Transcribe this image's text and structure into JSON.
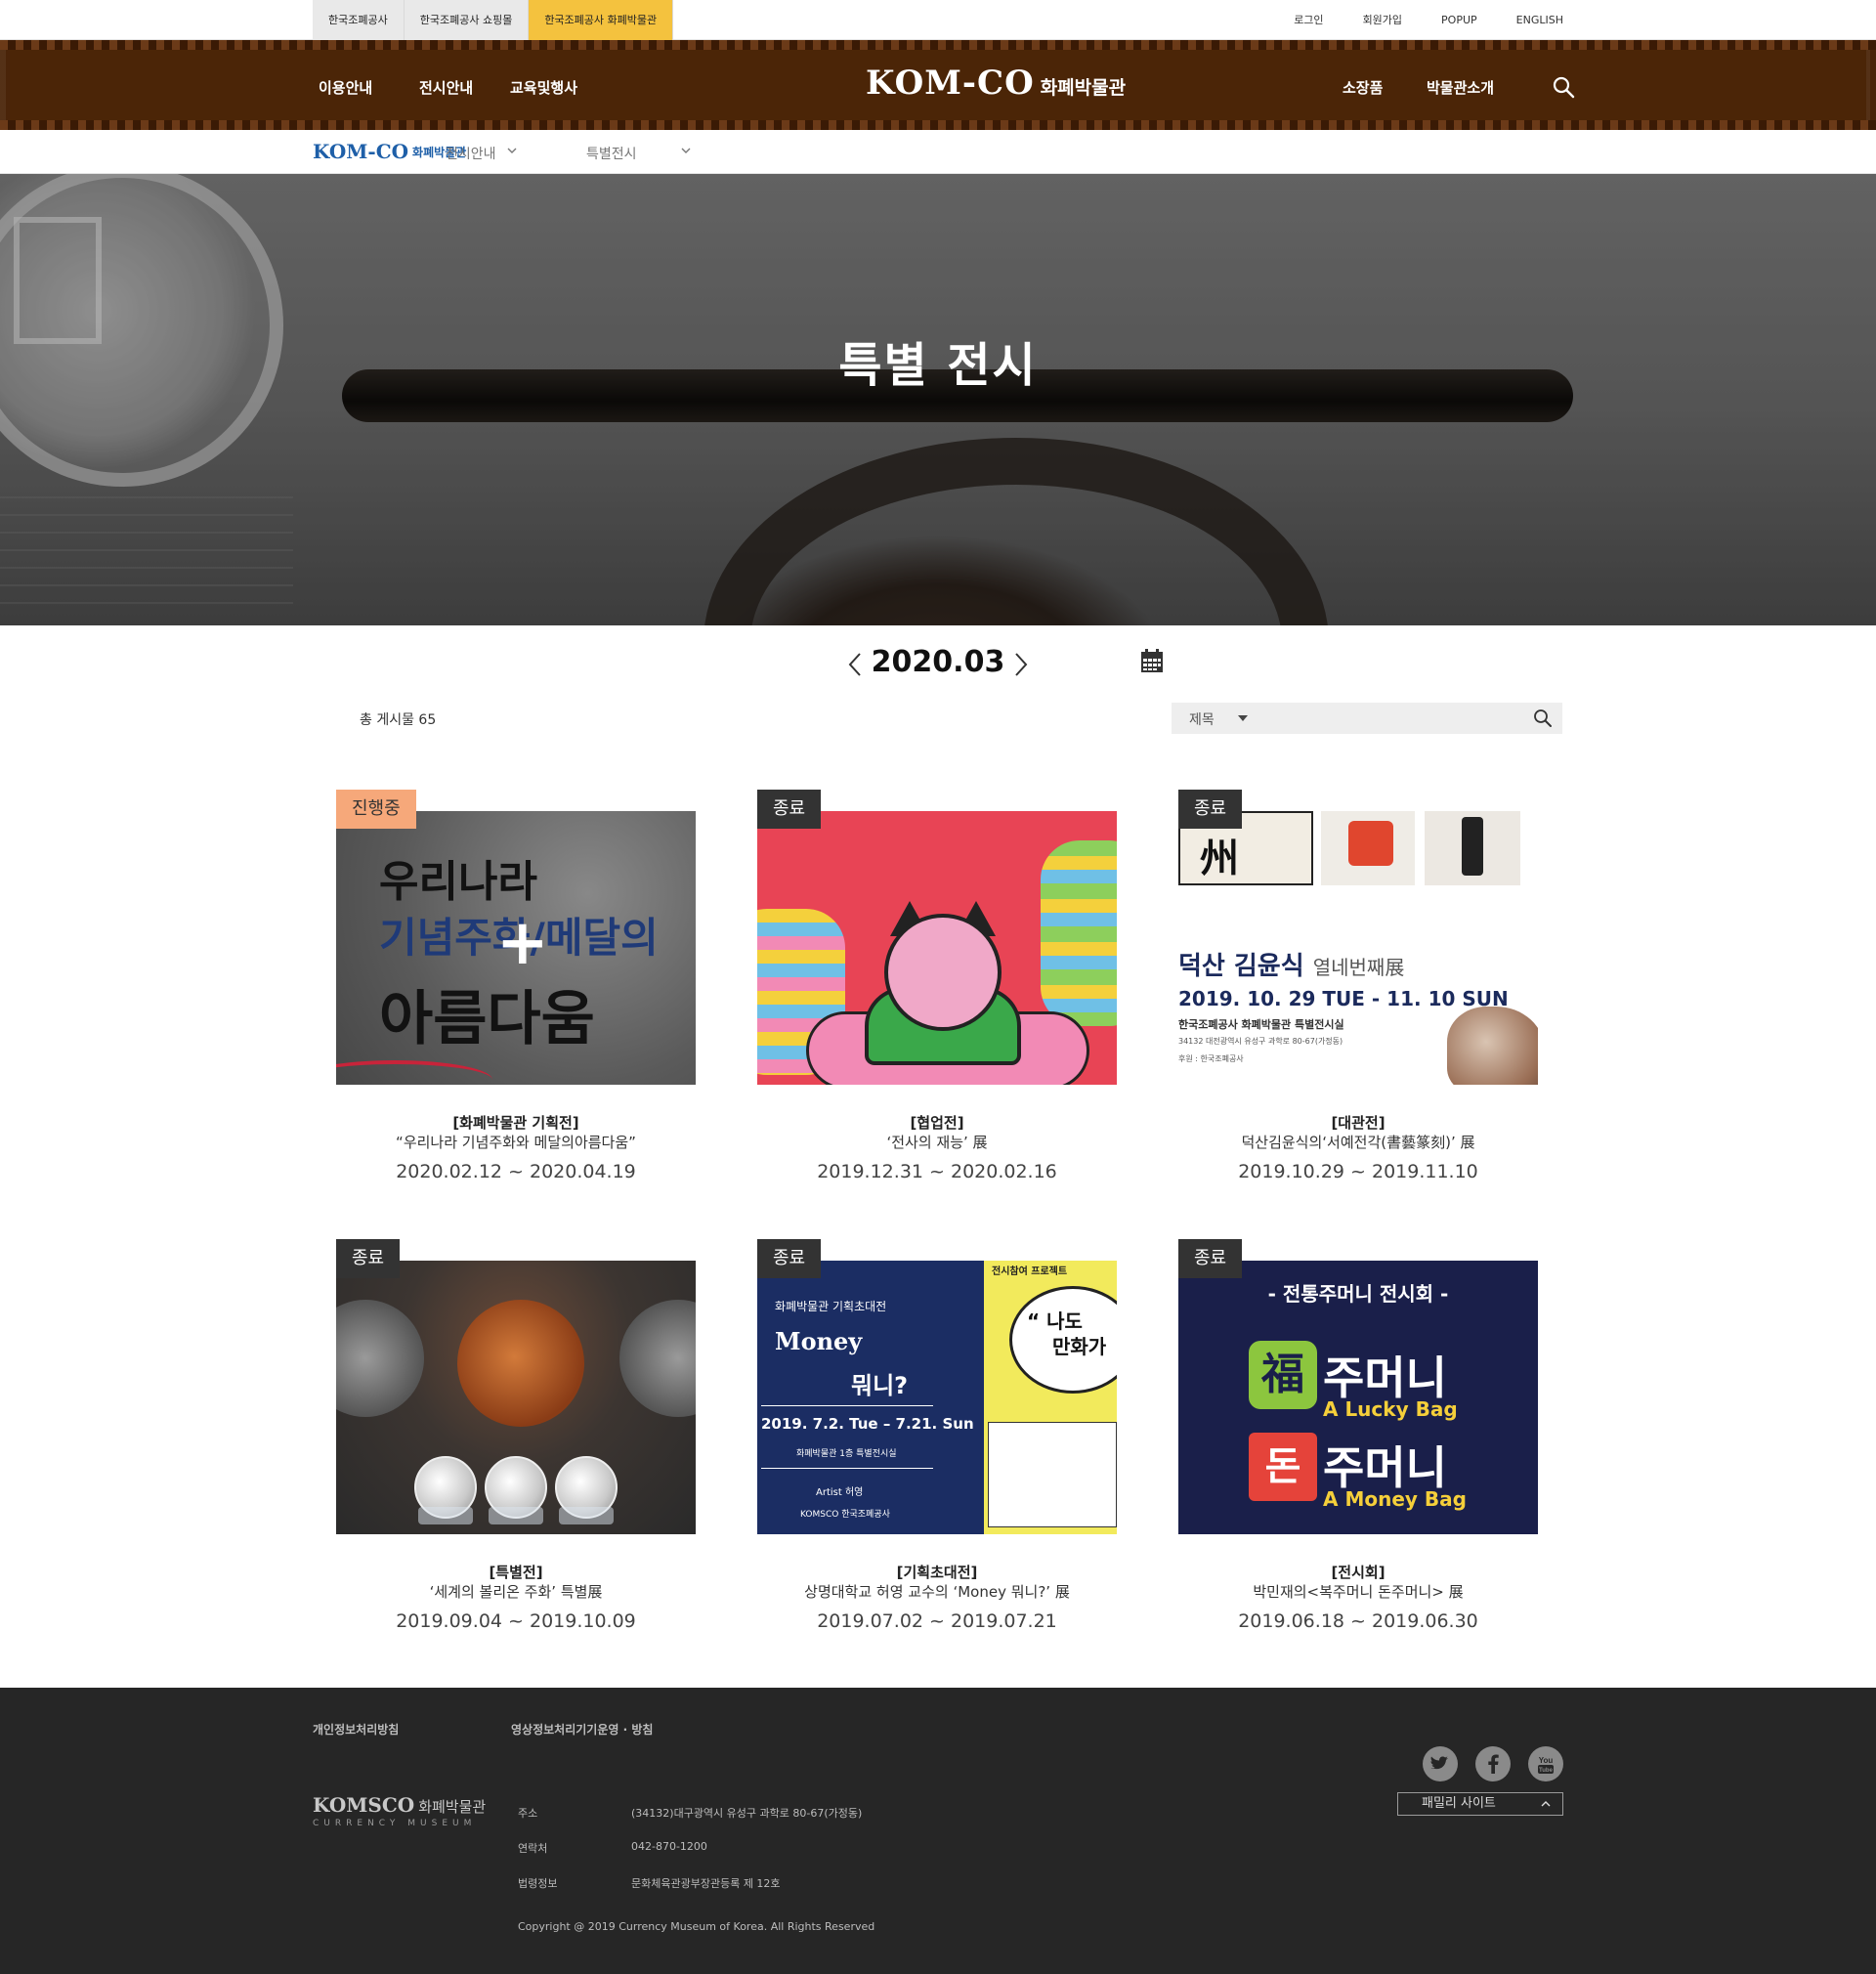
{
  "topbar": {
    "sites": [
      "한국조폐공사",
      "한국조폐공사 쇼핑몰",
      "한국조폐공사 화폐박물관"
    ],
    "active_site_index": 2,
    "util": [
      "로그인",
      "회원가입",
      "POPUP",
      "ENGLISH"
    ]
  },
  "nav": {
    "left": [
      "이용안내",
      "전시안내",
      "교육및행사"
    ],
    "right": [
      "소장품",
      "박물관소개"
    ],
    "logo_mark": "KOM-CO",
    "logo_name": "화폐박물관"
  },
  "breadcrumb": {
    "logo_mark": "KOM-CO",
    "logo_name": "화폐박물관",
    "level1": "전시안내",
    "level2": "특별전시"
  },
  "hero": {
    "title": "특별 전시"
  },
  "month": {
    "label": "2020.03"
  },
  "list": {
    "count_label": "총 게시물 65",
    "search_field": "제목",
    "search_value": ""
  },
  "cards": [
    {
      "status": "진행중",
      "category": "[화폐박물관 기획전]",
      "title": "“우리나라 기념주화와 메달의아름다움”",
      "dates": "2020.02.12 ~ 2020.04.19",
      "thumb": {
        "l1": "우리나라",
        "l2": "기념주화/메달의",
        "l3": "아름다움"
      }
    },
    {
      "status": "종료",
      "category": "[협업전]",
      "title": "‘전사의 재능’ 展",
      "dates": "2019.12.31 ~ 2020.02.16"
    },
    {
      "status": "종료",
      "category": "[대관전]",
      "title": "덕산김윤식의‘서예전각(書藝篆刻)’ 展",
      "dates": "2019.10.29 ~ 2019.11.10",
      "thumb": {
        "h": "덕산 김윤식",
        "h_small": "열네번째展",
        "d": "2019. 10. 29 TUE - 11. 10 SUN",
        "s": "한국조폐공사 화폐박물관 특별전시실",
        "s2": "34132 대전광역시 유성구 과학로 80-67(가정동)",
        "s3": "후원 : 한국조폐공사"
      }
    },
    {
      "status": "종료",
      "category": "[특별전]",
      "title": "‘세계의 볼리온 주화’ 특별展",
      "dates": "2019.09.04 ~ 2019.10.09"
    },
    {
      "status": "종료",
      "category": "[기획초대전]",
      "title": "상명대학교 허영 교수의 ‘Money 뭐니?’ 展",
      "dates": "2019.07.02 ~ 2019.07.21",
      "thumb": {
        "a": "화폐박물관 기획초대전",
        "b": "Money",
        "c": "뭐니?",
        "d": "2019. 7.2. Tue – 7.21. Sun",
        "e": "화폐박물관 1층 특별전시실",
        "f": "Artist  허영",
        "g": "KOMSCO 한국조폐공사",
        "rtop": "전시참여 프로젝트",
        "r1": "“ 나도",
        "r2": "만화가"
      }
    },
    {
      "status": "종료",
      "category": "[전시회]",
      "title": "박민재의<복주머니 돈주머니> 展",
      "dates": "2019.06.18 ~ 2019.06.30",
      "thumb": {
        "top": "- 전통주머니 전시회 -",
        "fuk": "福",
        "don": "돈",
        "w1": "주머니",
        "e1": "A Lucky Bag",
        "w2": "주머니",
        "e2": "A Money Bag"
      }
    }
  ],
  "footer": {
    "links": [
      "개인정보처리방침",
      "영상정보처리기기운영 · 방침"
    ],
    "logo_mark": "KOMSCO",
    "logo_name": "화폐박물관",
    "logo_sub": "CURRENCY MUSEUM",
    "rows": [
      {
        "label": "주소",
        "value": "(34132)대구광역시 유성구 과학로 80-67(가정동)"
      },
      {
        "label": "연락처",
        "value": "042-870-1200"
      },
      {
        "label": "법령정보",
        "value": "문화체육관광부장관등록 제 12호"
      }
    ],
    "copyright": "Copyright @ 2019 Currency Museum of Korea. All Rights Reserved",
    "family_label": "패밀리 사이트",
    "social": [
      "twitter-icon",
      "facebook-icon",
      "youtube-icon"
    ]
  },
  "colors": {
    "nav_bg": "#4b2507",
    "active_site": "#f4c23e",
    "badge_on": "#f6a87a",
    "badge_off": "#333333",
    "footer_bg": "#262626"
  }
}
